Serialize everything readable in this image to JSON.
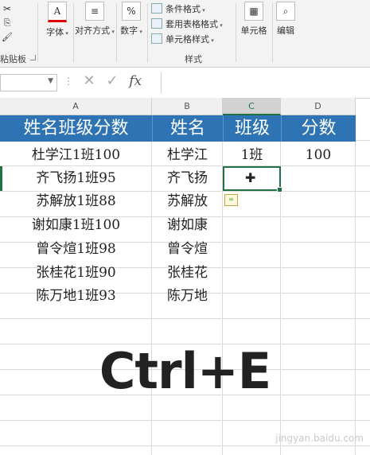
{
  "ribbon": {
    "font": {
      "label": "字体",
      "icon": "font-color-icon",
      "glyph": "A"
    },
    "align": {
      "label": "对齐方式",
      "icon": "align-icon",
      "glyph": "≡"
    },
    "number": {
      "label": "数字",
      "icon": "percent-icon",
      "glyph": "%"
    },
    "styles": {
      "conditional": "条件格式",
      "table_format": "套用表格格式",
      "cell_style": "单元格样式",
      "group_label": "样式"
    },
    "cells": {
      "label": "单元格",
      "icon": "cells-icon",
      "glyph": "▦"
    },
    "editing": {
      "label": "编辑",
      "icon": "find-icon",
      "glyph": "⌕"
    },
    "clipboard": {
      "label": "粘贴板"
    }
  },
  "formula_bar": {
    "cancel": "✕",
    "enter": "✓",
    "fx": "fx",
    "dots": "⋮"
  },
  "columns": [
    "A",
    "B",
    "C",
    "D"
  ],
  "sheet": {
    "headers": [
      "姓名班级分数",
      "姓名",
      "班级",
      "分数"
    ],
    "rows": [
      {
        "a": "杜学江1班100",
        "b": "杜学江",
        "c": "1班",
        "d": "100"
      },
      {
        "a": "齐飞扬1班95",
        "b": "齐飞扬",
        "c": "",
        "d": ""
      },
      {
        "a": "苏解放1班88",
        "b": "苏解放",
        "c": "",
        "d": ""
      },
      {
        "a": "谢如康1班100",
        "b": "谢如康",
        "c": "",
        "d": ""
      },
      {
        "a": "曾令煊1班98",
        "b": "曾令煊",
        "c": "",
        "d": ""
      },
      {
        "a": "张桂花1班90",
        "b": "张桂花",
        "c": "",
        "d": ""
      },
      {
        "a": "陈万地1班93",
        "b": "陈万地",
        "c": "",
        "d": ""
      }
    ]
  },
  "overlay_text": "Ctrl+E",
  "watermark": "jingyan.baidu.com",
  "colors": {
    "header_bg": "#2e74b5",
    "select": "#217346"
  }
}
